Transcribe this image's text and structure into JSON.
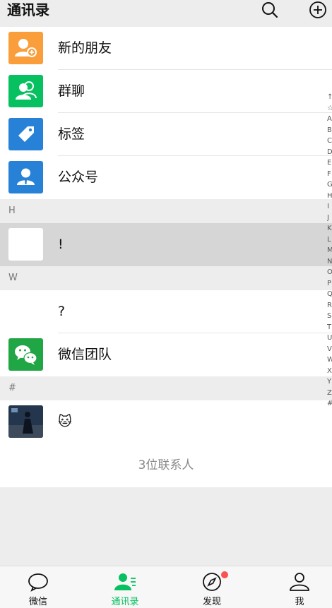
{
  "header": {
    "title": "通讯录"
  },
  "function_items": [
    {
      "label": "新的朋友",
      "color": "#fa9d3b"
    },
    {
      "label": "群聊",
      "color": "#07c160"
    },
    {
      "label": "标签",
      "color": "#2782d7"
    },
    {
      "label": "公众号",
      "color": "#2782d7"
    }
  ],
  "sections": [
    {
      "letter": "H",
      "contacts": [
        {
          "name": "!"
        }
      ]
    },
    {
      "letter": "W",
      "contacts": [
        {
          "name": "?"
        },
        {
          "name": "微信团队"
        }
      ]
    },
    {
      "letter": "#",
      "contacts": [
        {
          "name": "🐱"
        }
      ]
    }
  ],
  "footer": {
    "count_text": "3位联系人"
  },
  "index_letters": [
    "↑",
    "☆",
    "A",
    "B",
    "C",
    "D",
    "E",
    "F",
    "G",
    "H",
    "I",
    "J",
    "K",
    "L",
    "M",
    "N",
    "O",
    "P",
    "Q",
    "R",
    "S",
    "T",
    "U",
    "V",
    "W",
    "X",
    "Y",
    "Z",
    "#"
  ],
  "tabs": [
    {
      "label": "微信",
      "active": false
    },
    {
      "label": "通讯录",
      "active": true
    },
    {
      "label": "发现",
      "active": false,
      "badge": true
    },
    {
      "label": "我",
      "active": false
    }
  ],
  "colors": {
    "accent": "#07c160",
    "badge": "#fa5151",
    "highlight_row": "#d6d6d6"
  }
}
